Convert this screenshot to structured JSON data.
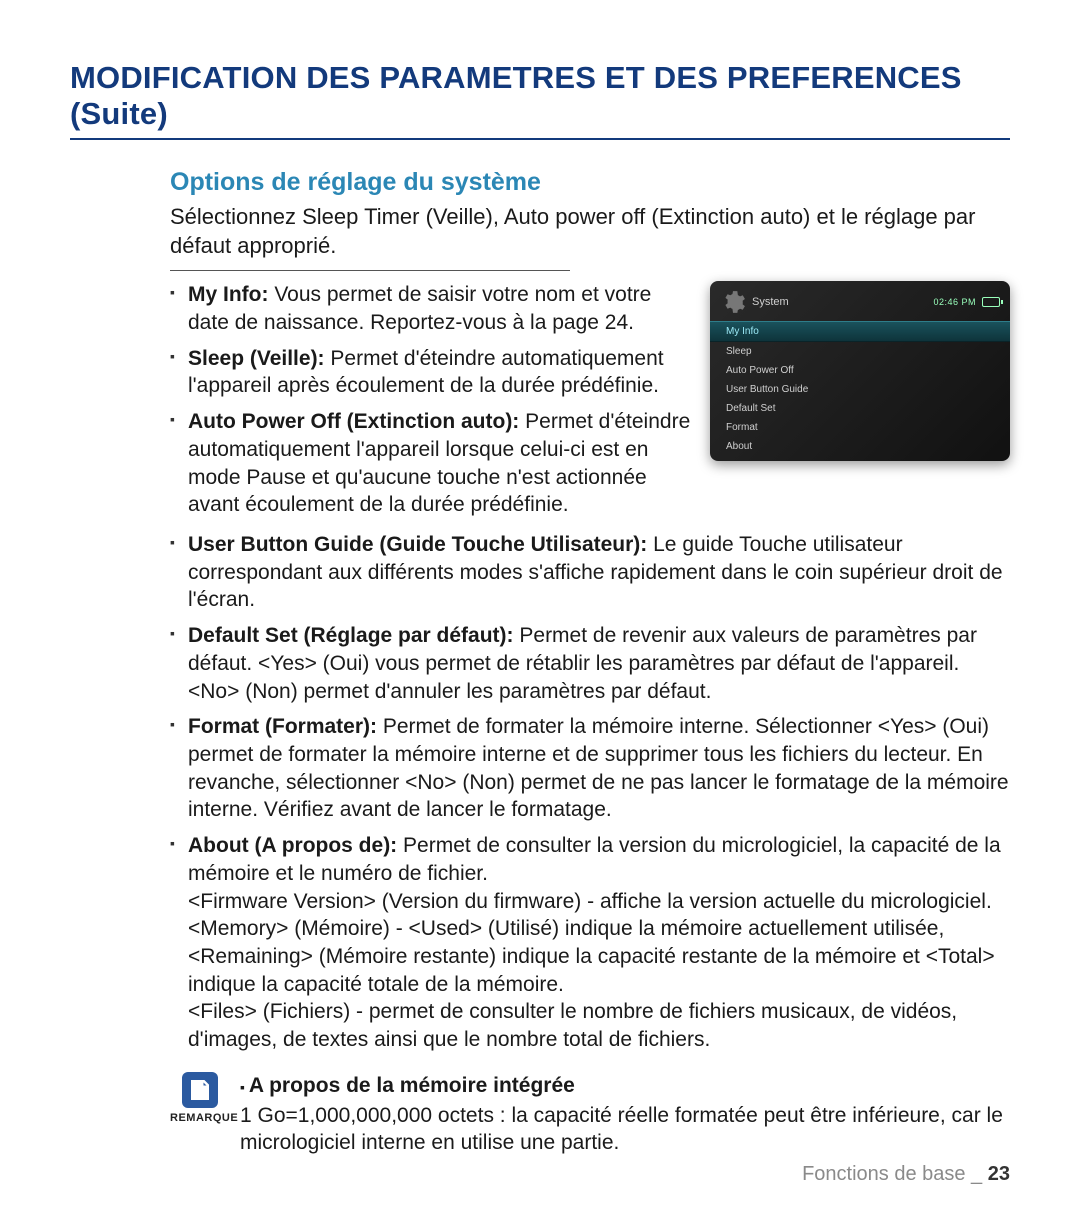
{
  "title": "MODIFICATION DES PARAMETRES ET DES PREFERENCES (Suite)",
  "subhead": "Options de réglage du système",
  "intro": "Sélectionnez Sleep Timer (Veille), Auto power off (Extinction auto) et le réglage par défaut approprié.",
  "bullets": {
    "my_info_b": "My Info:",
    "my_info": " Vous permet de saisir votre nom et votre date de naissance. Reportez-vous à la page 24.",
    "sleep_b": "Sleep (Veille):",
    "sleep": " Permet d'éteindre automatiquement l'appareil après écoulement de la durée prédéfinie.",
    "apo_b": "Auto Power Off (Extinction auto):",
    "apo": " Permet d'éteindre automatiquement l'appareil lorsque celui-ci est en mode Pause et qu'aucune touche n'est actionnée avant écoulement de la durée prédéfinie.",
    "ubg_b": "User Button Guide (Guide Touche Utilisateur):",
    "ubg": " Le guide Touche utilisateur correspondant aux différents modes s'affiche rapidement dans le coin supérieur droit de l'écran.",
    "def_b": "Default Set (Réglage par défaut):",
    "def": " Permet de revenir aux valeurs de paramètres par défaut. <Yes> (Oui) vous permet de rétablir les paramètres par défaut de l'appareil. <No> (Non) permet d'annuler les paramètres par défaut.",
    "fmt_b": "Format (Formater):",
    "fmt": " Permet de formater la mémoire interne. Sélectionner <Yes> (Oui) permet de formater la mémoire interne et de supprimer tous les fichiers du lecteur. En revanche, sélectionner <No> (Non) permet de ne pas lancer le formatage de la mémoire interne. Vérifiez avant de lancer le formatage.",
    "about_b": "About (A propos de):",
    "about": " Permet de consulter la version du micrologiciel, la capacité de la mémoire et le numéro de fichier.",
    "about_fw": "<Firmware Version> (Version du firmware) - affiche la version actuelle du micrologiciel.",
    "about_mem": "<Memory> (Mémoire) -  <Used> (Utilisé) indique la mémoire actuellement utilisée, <Remaining> (Mémoire restante) indique la capacité restante de la mémoire et <Total> indique la capacité totale de la mémoire.",
    "about_files": "<Files> (Fichiers) - permet de consulter le nombre de fichiers musicaux, de vidéos, d'images, de textes ainsi que le nombre total de fichiers."
  },
  "device": {
    "title": "System",
    "time": "02:46 PM",
    "items": [
      "My Info",
      "Sleep",
      "Auto Power Off",
      "User Button Guide",
      "Default Set",
      "Format",
      "About"
    ],
    "selected": 0
  },
  "note": {
    "label": "REMARQUE",
    "head": "A propos de la mémoire intégrée",
    "body": "1 Go=1,000,000,000 octets : la capacité réelle formatée peut être inférieure, car le micrologiciel interne en utilise une partie."
  },
  "footer": {
    "section": "Fonctions de base _",
    "page": "23"
  }
}
